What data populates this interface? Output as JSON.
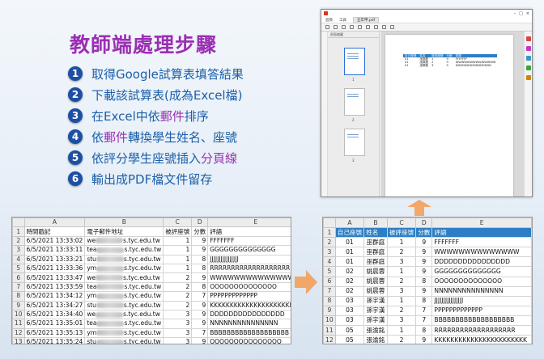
{
  "title": "教師端處理步驟",
  "steps": [
    {
      "num": "1",
      "text": "取得Google試算表填答結果"
    },
    {
      "num": "2",
      "text": "下載該試算表(成為Excel檔)"
    },
    {
      "num": "3",
      "pre": "在Excel中依",
      "hl": "郵件",
      "post": "排序"
    },
    {
      "num": "4",
      "pre": "依",
      "hl": "郵件",
      "post": "轉換學生姓名、座號"
    },
    {
      "num": "5",
      "pre": "依評分學生座號插入",
      "hl": "分頁線",
      "post": ""
    },
    {
      "num": "6",
      "text": "輸出成PDF檔文件留存"
    }
  ],
  "colors": {
    "title": "#9b2fb4",
    "steps": "#1a5fa8",
    "badge": "#1e4fa3",
    "header": "#2c7fc6",
    "arrow": "#f2a05a"
  },
  "pdf": {
    "menu": [
      "首頁",
      "工具",
      "五年甲.pdf"
    ],
    "pages_header": "頁面縮圖",
    "thumb_labels": [
      "1",
      "2",
      "3"
    ],
    "table": [
      [
        "自己座號",
        "姓名",
        "被評座號",
        "分數",
        "評語"
      ],
      [
        "01",
        "巫群庭",
        "1",
        "9",
        "FFFFFFF"
      ],
      [
        "01",
        "巫群庭",
        "2",
        "9",
        "WWWWWWWWWWWWWW"
      ],
      [
        "01",
        "巫群庭",
        "3",
        "9",
        "DDDDDDDDDDDDDDDD"
      ]
    ]
  },
  "left_sheet": {
    "columns": [
      "",
      "A",
      "B",
      "C",
      "D",
      "E"
    ],
    "header": [
      "時間戳記",
      "電子郵件地址",
      "被評座號",
      "分數",
      "評語"
    ],
    "rows": [
      {
        "n": "2",
        "ts": "6/5/2021 13:33:02",
        "ep": "we",
        "es": "s.tyc.edu.tw",
        "s": "1",
        "sc": "9",
        "c": "FFFFFFF"
      },
      {
        "n": "3",
        "ts": "6/5/2021 13:33:11",
        "ep": "tea",
        "es": "s.tyc.edu.tw",
        "s": "1",
        "sc": "9",
        "c": "GGGGGGGGGGGGGG"
      },
      {
        "n": "4",
        "ts": "6/5/2021 13:33:21",
        "ep": "stu",
        "es": "s.tyc.edu.tw",
        "s": "1",
        "sc": "8",
        "c": "JJJJJJJJJJJJJJJJ"
      },
      {
        "n": "5",
        "ts": "6/5/2021 13:33:36",
        "ep": "ym",
        "es": "s.tyc.edu.tw",
        "s": "1",
        "sc": "8",
        "c": "RRRRRRRRRRRRRRRRRRR"
      },
      {
        "n": "6",
        "ts": "6/5/2021 13:33:47",
        "ep": "we",
        "es": "s.tyc.edu.tw",
        "s": "2",
        "sc": "9",
        "c": "WWWWWWWWWWWWWW"
      },
      {
        "n": "7",
        "ts": "6/5/2021 13:33:59",
        "ep": "tea",
        "es": "s.tyc.edu.tw",
        "s": "2",
        "sc": "8",
        "c": "OOOOOOOOOOOOOO"
      },
      {
        "n": "8",
        "ts": "6/5/2021 13:34:12",
        "ep": "ym",
        "es": "s.tyc.edu.tw",
        "s": "2",
        "sc": "7",
        "c": "PPPPPPPPPPPPP"
      },
      {
        "n": "9",
        "ts": "6/5/2021 13:34:27",
        "ep": "stu",
        "es": "s.tyc.edu.tw",
        "s": "2",
        "sc": "9",
        "c": "KKKKKKKKKKKKKKKKKKKKKKK"
      },
      {
        "n": "10",
        "ts": "6/5/2021 13:34:40",
        "ep": "we",
        "es": "s.tyc.edu.tw",
        "s": "3",
        "sc": "9",
        "c": "DDDDDDDDDDDDDDDD"
      },
      {
        "n": "11",
        "ts": "6/5/2021 13:35:01",
        "ep": "tea",
        "es": "s.tyc.edu.tw",
        "s": "3",
        "sc": "9",
        "c": "NNNNNNNNNNNNNNN"
      },
      {
        "n": "12",
        "ts": "6/5/2021 13:35:13",
        "ep": "ym",
        "es": "s.tyc.edu.tw",
        "s": "3",
        "sc": "7",
        "c": "BBBBBBBBBBBBBBBBBBB"
      },
      {
        "n": "13",
        "ts": "6/5/2021 13:35:24",
        "ep": "stu",
        "es": "s.tyc.edu.tw",
        "s": "3",
        "sc": "9",
        "c": "QQQQQQQQQQQQQQQ"
      }
    ]
  },
  "right_sheet": {
    "columns": [
      "",
      "A",
      "B",
      "C",
      "D",
      "E"
    ],
    "header": [
      "自己座號",
      "姓名",
      "被評座號",
      "分數",
      "評語"
    ],
    "rows": [
      {
        "n": "2",
        "a": "01",
        "b": "巫群庭",
        "c": "1",
        "d": "9",
        "e": "FFFFFFF",
        "sep": false
      },
      {
        "n": "3",
        "a": "01",
        "b": "巫群庭",
        "c": "2",
        "d": "9",
        "e": "WWWWWWWWWWWWWW",
        "sep": false
      },
      {
        "n": "4",
        "a": "01",
        "b": "巫群庭",
        "c": "3",
        "d": "9",
        "e": "DDDDDDDDDDDDDDDD",
        "sep": false
      },
      {
        "n": "5",
        "a": "02",
        "b": "姚晨蓉",
        "c": "1",
        "d": "9",
        "e": "GGGGGGGGGGGGGG",
        "sep": true
      },
      {
        "n": "6",
        "a": "02",
        "b": "姚晨蓉",
        "c": "2",
        "d": "8",
        "e": "OOOOOOOOOOOOOO",
        "sep": false
      },
      {
        "n": "7",
        "a": "02",
        "b": "姚晨蓉",
        "c": "3",
        "d": "9",
        "e": "NNNNNNNNNNNNNNN",
        "sep": false
      },
      {
        "n": "8",
        "a": "03",
        "b": "孫宇漢",
        "c": "1",
        "d": "8",
        "e": "JJJJJJJJJJJJJJJJ",
        "sep": true
      },
      {
        "n": "9",
        "a": "03",
        "b": "孫宇漢",
        "c": "2",
        "d": "7",
        "e": "PPPPPPPPPPPPP",
        "sep": false
      },
      {
        "n": "10",
        "a": "03",
        "b": "孫宇漢",
        "c": "3",
        "d": "7",
        "e": "BBBBBBBBBBBBBBBBBBB",
        "sep": false
      },
      {
        "n": "11",
        "a": "05",
        "b": "張渝銘",
        "c": "1",
        "d": "8",
        "e": "RRRRRRRRRRRRRRRRRRR",
        "sep": true
      },
      {
        "n": "12",
        "a": "05",
        "b": "張渝銘",
        "c": "2",
        "d": "9",
        "e": "KKKKKKKKKKKKKKKKKKKKKKK",
        "sep": false
      },
      {
        "n": "13",
        "a": "05",
        "b": "張渝銘",
        "c": "3",
        "d": "9",
        "e": "QQQQQQQQQQQQQQQ",
        "sep": false
      }
    ]
  }
}
